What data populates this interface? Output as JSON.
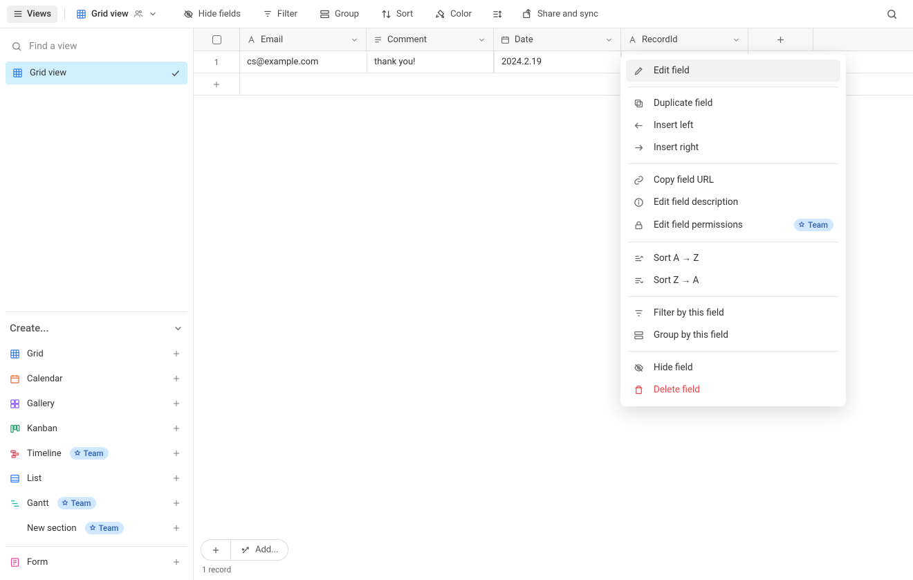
{
  "toolbar": {
    "views_label": "Views",
    "current_view": "Grid view",
    "buttons": {
      "hide_fields": "Hide fields",
      "filter": "Filter",
      "group": "Group",
      "sort": "Sort",
      "color": "Color",
      "share": "Share and sync"
    }
  },
  "sidebar": {
    "find_placeholder": "Find a view",
    "views": [
      {
        "label": "Grid view",
        "selected": true
      }
    ],
    "create_header": "Create...",
    "create_items": [
      {
        "label": "Grid",
        "icon": "grid",
        "color": "#2d7ff9"
      },
      {
        "label": "Calendar",
        "icon": "calendar",
        "color": "#ef6a2f"
      },
      {
        "label": "Gallery",
        "icon": "gallery",
        "color": "#8b5cf6"
      },
      {
        "label": "Kanban",
        "icon": "kanban",
        "color": "#22a06b"
      },
      {
        "label": "Timeline",
        "icon": "timeline",
        "color": "#e8445a",
        "team": true
      },
      {
        "label": "List",
        "icon": "list",
        "color": "#2d7ff9"
      },
      {
        "label": "Gantt",
        "icon": "gantt",
        "color": "#14b8a6",
        "team": true
      },
      {
        "label": "New section",
        "icon": "",
        "color": "#333333",
        "team": true
      }
    ],
    "team_pill": "Team",
    "form_label": "Form"
  },
  "grid": {
    "columns": [
      {
        "key": "email",
        "label": "Email",
        "type": "text"
      },
      {
        "key": "comment",
        "label": "Comment",
        "type": "longtext"
      },
      {
        "key": "date",
        "label": "Date",
        "type": "date"
      },
      {
        "key": "recordid",
        "label": "RecordId",
        "type": "text"
      }
    ],
    "rows": [
      {
        "num": "1",
        "email": "cs@example.com",
        "comment": "thank you!",
        "date": "2024.2.19",
        "recordid": ""
      }
    ],
    "add_label": "Add...",
    "records_count": "1 record"
  },
  "context_menu": {
    "items": [
      {
        "key": "edit",
        "label": "Edit field",
        "icon": "pencil",
        "hovered": true
      },
      {
        "sep": true
      },
      {
        "key": "duplicate",
        "label": "Duplicate field",
        "icon": "duplicate"
      },
      {
        "key": "insert_left",
        "label": "Insert left",
        "icon": "arrow-left"
      },
      {
        "key": "insert_right",
        "label": "Insert right",
        "icon": "arrow-right"
      },
      {
        "sep": true
      },
      {
        "key": "copy_url",
        "label": "Copy field URL",
        "icon": "link"
      },
      {
        "key": "edit_desc",
        "label": "Edit field description",
        "icon": "info"
      },
      {
        "key": "edit_perm",
        "label": "Edit field permissions",
        "icon": "lock",
        "pill": "Team"
      },
      {
        "sep": true
      },
      {
        "key": "sort_az",
        "label": "Sort A → Z",
        "icon": "sort-asc"
      },
      {
        "key": "sort_za",
        "label": "Sort Z → A",
        "icon": "sort-desc"
      },
      {
        "sep": true
      },
      {
        "key": "filter_by",
        "label": "Filter by this field",
        "icon": "filter"
      },
      {
        "key": "group_by",
        "label": "Group by this field",
        "icon": "group"
      },
      {
        "sep": true
      },
      {
        "key": "hide",
        "label": "Hide field",
        "icon": "eye-off"
      },
      {
        "key": "delete",
        "label": "Delete field",
        "icon": "trash",
        "danger": true
      }
    ]
  }
}
